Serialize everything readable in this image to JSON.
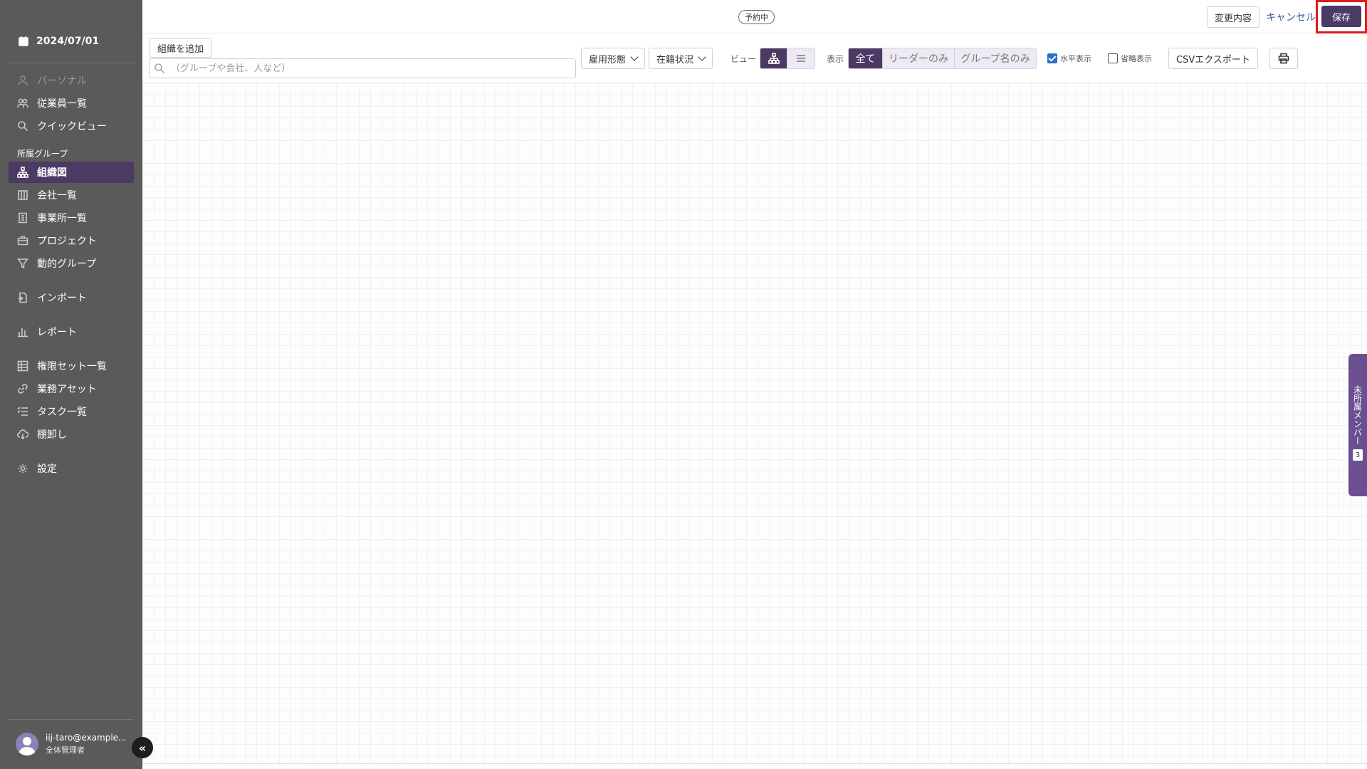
{
  "sidebar": {
    "date": "2024/07/01",
    "items": [
      {
        "label": "パーソナル"
      },
      {
        "label": "従業員一覧"
      },
      {
        "label": "クイックビュー"
      },
      {
        "label": "組織図"
      },
      {
        "label": "会社一覧"
      },
      {
        "label": "事業所一覧"
      },
      {
        "label": "プロジェクト"
      },
      {
        "label": "動的グループ"
      },
      {
        "label": "インポート"
      },
      {
        "label": "レポート"
      },
      {
        "label": "権限セット一覧"
      },
      {
        "label": "業務アセット"
      },
      {
        "label": "タスク一覧"
      },
      {
        "label": "棚卸し"
      },
      {
        "label": "設定"
      }
    ],
    "section_label": "所属グループ",
    "active_item": "組織図",
    "user": {
      "email": "iij-taro@example...",
      "role": "全体管理者"
    },
    "collapse_glyph": "«"
  },
  "topbar": {
    "status": "予約中",
    "changes_label": "変更内容",
    "cancel_label": "キャンセル",
    "save_label": "保存"
  },
  "toolbar": {
    "add_org_label": "組織を追加",
    "search_placeholder": "（グループや会社、人など）",
    "employment_type_label": "雇用形態",
    "enrollment_status_label": "在籍状況",
    "view_label": "ビュー",
    "display_label": "表示",
    "display_options": [
      "全て",
      "リーダーのみ",
      "グループ名のみ"
    ],
    "display_selected": "全て",
    "horizontal_label": "水平表示",
    "horizontal_checked": true,
    "compact_label": "省略表示",
    "compact_checked": false,
    "csv_label": "CSVエクスポート"
  },
  "unassigned_tab": {
    "label": "未所属メンバー",
    "count": "3"
  },
  "colors": {
    "sidebar_bg": "#5a5a5a",
    "accent": "#4b3a63",
    "highlight": "#e0191c",
    "tab_bg": "#6b4f91"
  }
}
